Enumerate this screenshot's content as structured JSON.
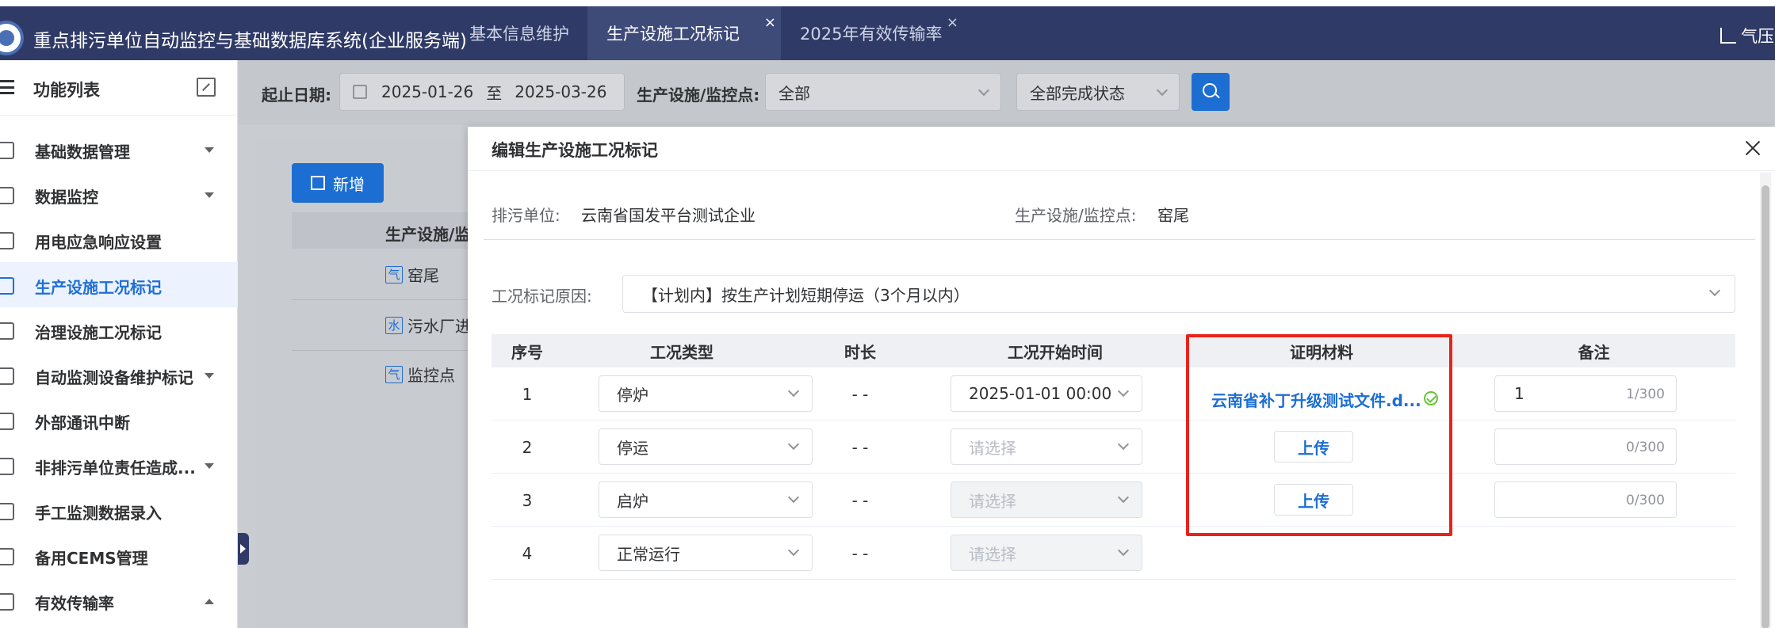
{
  "app": {
    "title": "重点排污单位自动监控与基础数据库系统(企业服务端)",
    "tabs": [
      {
        "label": "基本信息维护",
        "active": false,
        "closable": false
      },
      {
        "label": "生产设施工况标记",
        "active": true,
        "closable": true
      },
      {
        "label": "2025年有效传输率",
        "active": false,
        "closable": true
      }
    ],
    "close_glyph": "×",
    "user_label": "气压"
  },
  "sidebar": {
    "title": "功能列表",
    "items": [
      {
        "label": "基础数据管理",
        "icon": "database-icon",
        "caret": "down",
        "active": false
      },
      {
        "label": "数据监控",
        "icon": "monitor-icon",
        "caret": "down",
        "active": false
      },
      {
        "label": "用电应急响应设置",
        "icon": "power-icon",
        "caret": "",
        "active": false
      },
      {
        "label": "生产设施工况标记",
        "icon": "edit-list-icon",
        "caret": "",
        "active": true
      },
      {
        "label": "治理设施工况标记",
        "icon": "list-icon",
        "caret": "",
        "active": false
      },
      {
        "label": "自动监测设备维护标记",
        "icon": "wrench-icon",
        "caret": "down",
        "active": false
      },
      {
        "label": "外部通讯中断",
        "icon": "link-off-icon",
        "caret": "",
        "active": false
      },
      {
        "label": "非排污单位责任造成...",
        "icon": "flag-icon",
        "caret": "down",
        "active": false
      },
      {
        "label": "手工监测数据录入",
        "icon": "form-icon",
        "caret": "",
        "active": false
      },
      {
        "label": "备用CEMS管理",
        "icon": "device-icon",
        "caret": "",
        "active": false
      },
      {
        "label": "有效传输率",
        "icon": "pie-icon",
        "caret": "up",
        "active": false
      }
    ]
  },
  "filters": {
    "date_label": "起止日期:",
    "date_start": "2025-01-26",
    "date_sep": "至",
    "date_end": "2025-03-26",
    "point_label": "生产设施/监控点:",
    "point_value": "全部",
    "status_value": "全部完成状态"
  },
  "background": {
    "add_label": "新增",
    "col_header": "生产设施/监控点",
    "rows": [
      {
        "tag": "气",
        "label": "窑尾"
      },
      {
        "tag": "水",
        "label": "污水厂进"
      },
      {
        "tag": "气",
        "label": "监控点"
      }
    ]
  },
  "dialog": {
    "title": "编辑生产设施工况标记",
    "unit_label": "排污单位:",
    "unit_value": "云南省国发平台测试企业",
    "point_label": "生产设施/监控点:",
    "point_value": "窑尾",
    "reason_label": "工况标记原因:",
    "reason_value": "【计划内】按生产计划短期停运（3个月以内）",
    "columns": [
      "序号",
      "工况类型",
      "时长",
      "工况开始时间",
      "证明材料",
      "备注"
    ],
    "rows": [
      {
        "no": "1",
        "type": "停炉",
        "duration": "- -",
        "start": "2025-01-01 00:00",
        "start_disabled": false,
        "start_placeholder": false,
        "proof_file": "云南省补丁升级测试文件.d...",
        "upload": "",
        "remark": "1",
        "remark_count": "1/300"
      },
      {
        "no": "2",
        "type": "停运",
        "duration": "- -",
        "start": "请选择",
        "start_disabled": false,
        "start_placeholder": true,
        "proof_file": "",
        "upload": "上传",
        "remark": "",
        "remark_count": "0/300"
      },
      {
        "no": "3",
        "type": "启炉",
        "duration": "- -",
        "start": "请选择",
        "start_disabled": true,
        "start_placeholder": true,
        "proof_file": "",
        "upload": "上传",
        "remark": "",
        "remark_count": "0/300"
      },
      {
        "no": "4",
        "type": "正常运行",
        "duration": "- -",
        "start": "请选择",
        "start_disabled": true,
        "start_placeholder": true,
        "proof_file": "",
        "upload": "",
        "remark": "",
        "remark_count": ""
      }
    ]
  },
  "colors": {
    "nav_bg": "#2f3a67",
    "accent": "#1c6ed3",
    "highlight": "#e8231c",
    "success": "#67c23a"
  }
}
